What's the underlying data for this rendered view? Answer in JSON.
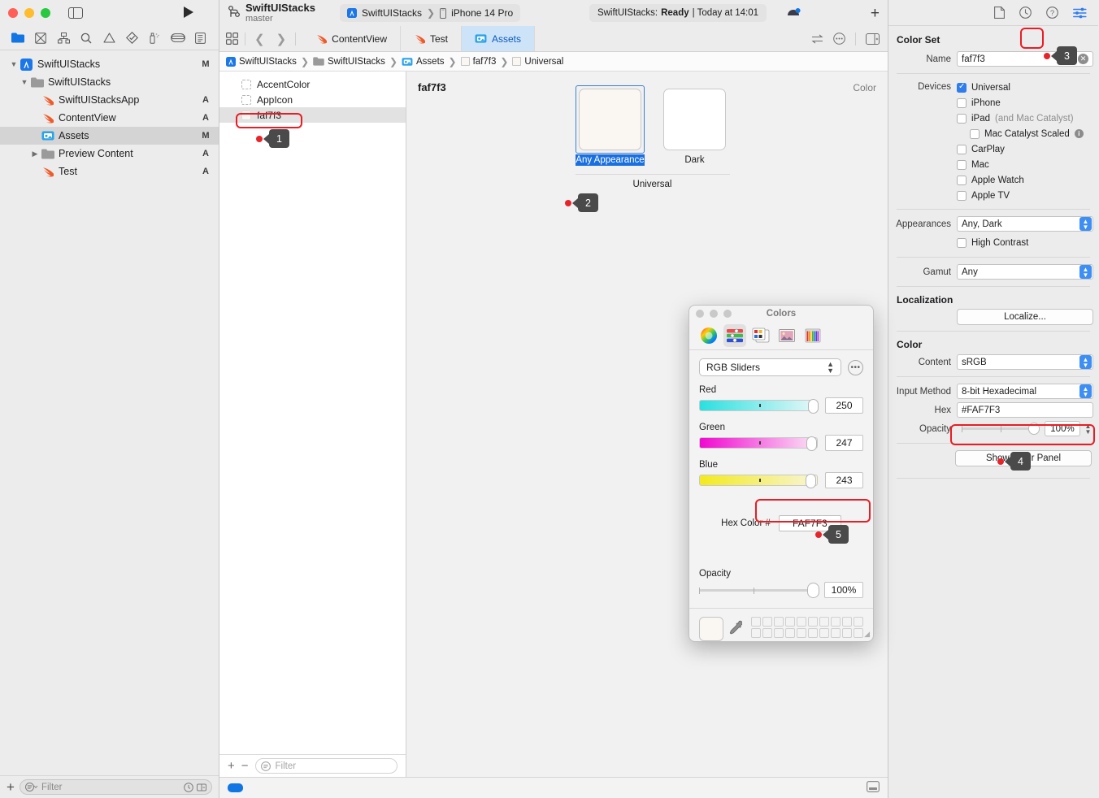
{
  "window": {
    "traffic_lights": [
      "close",
      "minimize",
      "zoom"
    ],
    "branch_title": "SwiftUIStacks",
    "branch_name": "master",
    "scheme_project": "SwiftUIStacks",
    "scheme_device": "iPhone 14 Pro",
    "status_prefix": "SwiftUIStacks:",
    "status_state": "Ready",
    "status_time": "| Today at 14:01",
    "add_label": "+"
  },
  "navigator": {
    "tabs": [
      {
        "name": "project-navigator-tab",
        "icon": "folder-icon"
      },
      {
        "name": "source-control-navigator-tab",
        "icon": "source-control-icon"
      },
      {
        "name": "symbol-navigator-tab",
        "icon": "hierarchy-icon"
      },
      {
        "name": "find-navigator-tab",
        "icon": "search-icon"
      },
      {
        "name": "issue-navigator-tab",
        "icon": "warning-icon"
      },
      {
        "name": "test-navigator-tab",
        "icon": "diamond-check-icon"
      },
      {
        "name": "debug-navigator-tab",
        "icon": "spray-icon"
      },
      {
        "name": "breakpoint-navigator-tab",
        "icon": "breakpoint-icon"
      },
      {
        "name": "report-navigator-tab",
        "icon": "report-icon"
      }
    ],
    "tree": [
      {
        "label": "SwiftUIStacks",
        "status": "M",
        "indent": 0,
        "twisty": "open",
        "icon": "xcode-project-icon"
      },
      {
        "label": "SwiftUIStacks",
        "status": "",
        "indent": 1,
        "twisty": "open",
        "icon": "folder-icon"
      },
      {
        "label": "SwiftUIStacksApp",
        "status": "A",
        "indent": 2,
        "twisty": "",
        "icon": "swift-file-icon"
      },
      {
        "label": "ContentView",
        "status": "A",
        "indent": 2,
        "twisty": "",
        "icon": "swift-file-icon"
      },
      {
        "label": "Assets",
        "status": "M",
        "indent": 2,
        "twisty": "",
        "icon": "assets-icon",
        "selected": true
      },
      {
        "label": "Preview Content",
        "status": "A",
        "indent": 1,
        "twisty": "closed",
        "icon": "folder-icon"
      },
      {
        "label": "Test",
        "status": "A",
        "indent": 2,
        "twisty": "",
        "icon": "swift-file-icon"
      }
    ],
    "filter_placeholder": "Filter"
  },
  "editor": {
    "tabs": [
      {
        "label": "ContentView",
        "icon": "swift-file-icon",
        "active": false
      },
      {
        "label": "Test",
        "icon": "swift-file-icon",
        "active": false
      },
      {
        "label": "Assets",
        "icon": "assets-icon",
        "active": true
      }
    ],
    "breadcrumbs": [
      {
        "label": "SwiftUIStacks",
        "icon": "xcode-project-icon"
      },
      {
        "label": "SwiftUIStacks",
        "icon": "folder-icon"
      },
      {
        "label": "Assets",
        "icon": "assets-icon"
      },
      {
        "label": "faf7f3",
        "icon": "color-swatch-icon"
      },
      {
        "label": "Universal",
        "icon": "color-swatch-icon"
      }
    ],
    "assets": [
      {
        "label": "AccentColor",
        "kind": "dashed",
        "selected": false
      },
      {
        "label": "AppIcon",
        "kind": "dashed",
        "selected": false
      },
      {
        "label": "faf7f3",
        "kind": "solid",
        "selected": true
      }
    ],
    "assets_filter_placeholder": "Filter",
    "canvas_title": "faf7f3",
    "canvas_kind": "Color",
    "swatches": [
      {
        "caption": "Any Appearance",
        "color": "#faf7f3",
        "selected": true
      },
      {
        "caption": "Dark",
        "color": "#ffffff",
        "selected": false
      }
    ],
    "universal_label": "Universal"
  },
  "inspector": {
    "tabs": [
      {
        "name": "file-inspector-tab",
        "icon": "document-icon"
      },
      {
        "name": "history-inspector-tab",
        "icon": "clock-icon"
      },
      {
        "name": "quick-help-inspector-tab",
        "icon": "help-icon"
      },
      {
        "name": "attributes-inspector-tab",
        "icon": "sliders-icon",
        "highlighted": true
      }
    ],
    "color_set": {
      "section": "Color Set",
      "name_label": "Name",
      "name_value": "faf7f3",
      "devices_label": "Devices",
      "devices": [
        {
          "label": "Universal",
          "checked": true,
          "indent": 0
        },
        {
          "label": "iPhone",
          "checked": false,
          "indent": 0
        },
        {
          "label": "iPad",
          "suffix": "(and Mac Catalyst)",
          "checked": false,
          "indent": 0
        },
        {
          "label": "Mac Catalyst Scaled",
          "checked": false,
          "indent": 1,
          "info": true
        },
        {
          "label": "CarPlay",
          "checked": false,
          "indent": 0
        },
        {
          "label": "Mac",
          "checked": false,
          "indent": 0
        },
        {
          "label": "Apple Watch",
          "checked": false,
          "indent": 0
        },
        {
          "label": "Apple TV",
          "checked": false,
          "indent": 0
        }
      ],
      "appearances_label": "Appearances",
      "appearances_value": "Any, Dark",
      "high_contrast_label": "High Contrast",
      "high_contrast_checked": false,
      "gamut_label": "Gamut",
      "gamut_value": "Any",
      "localization_section": "Localization",
      "localize_button": "Localize..."
    },
    "color": {
      "section": "Color",
      "content_label": "Content",
      "content_value": "sRGB",
      "input_method_label": "Input Method",
      "input_method_value": "8-bit Hexadecimal",
      "hex_label": "Hex",
      "hex_value": "#FAF7F3",
      "opacity_label": "Opacity",
      "opacity_value": "100%",
      "show_color_panel_button": "Show Color Panel"
    }
  },
  "colors_panel": {
    "title": "Colors",
    "tabs": [
      {
        "name": "color-wheel-tab",
        "active": false
      },
      {
        "name": "color-sliders-tab",
        "active": true
      },
      {
        "name": "color-palettes-tab",
        "active": false
      },
      {
        "name": "image-palettes-tab",
        "active": false
      },
      {
        "name": "pencils-tab",
        "active": false
      }
    ],
    "mode_select": "RGB Sliders",
    "sliders": [
      {
        "label": "Red",
        "value": "250",
        "from": "#2ae0e0",
        "to": "#e8f7f7"
      },
      {
        "label": "Green",
        "value": "247",
        "from": "#f008d0",
        "to": "#fbe5f5"
      },
      {
        "label": "Blue",
        "value": "243",
        "from": "#f3ea1e",
        "to": "#f7f4d2"
      }
    ],
    "hex_label": "Hex Color #",
    "hex_value": "FAF7F3",
    "opacity_label": "Opacity",
    "opacity_value": "100%",
    "current_color": "#faf7f3",
    "palette_rows": 2,
    "palette_cols": 10
  },
  "annotations": [
    {
      "number": "1",
      "target": "asset-faf7f3-row"
    },
    {
      "number": "2",
      "target": "any-appearance-swatch"
    },
    {
      "number": "3",
      "target": "attributes-inspector-tab"
    },
    {
      "number": "4",
      "target": "show-color-panel-button"
    },
    {
      "number": "5",
      "target": "hex-color-field"
    }
  ],
  "colors": {
    "accent": "#1a6fe0",
    "annotation_red": "#ec1c24",
    "annotation_badge": "#4a4a4a",
    "swatch_color": "#FAF7F3"
  }
}
